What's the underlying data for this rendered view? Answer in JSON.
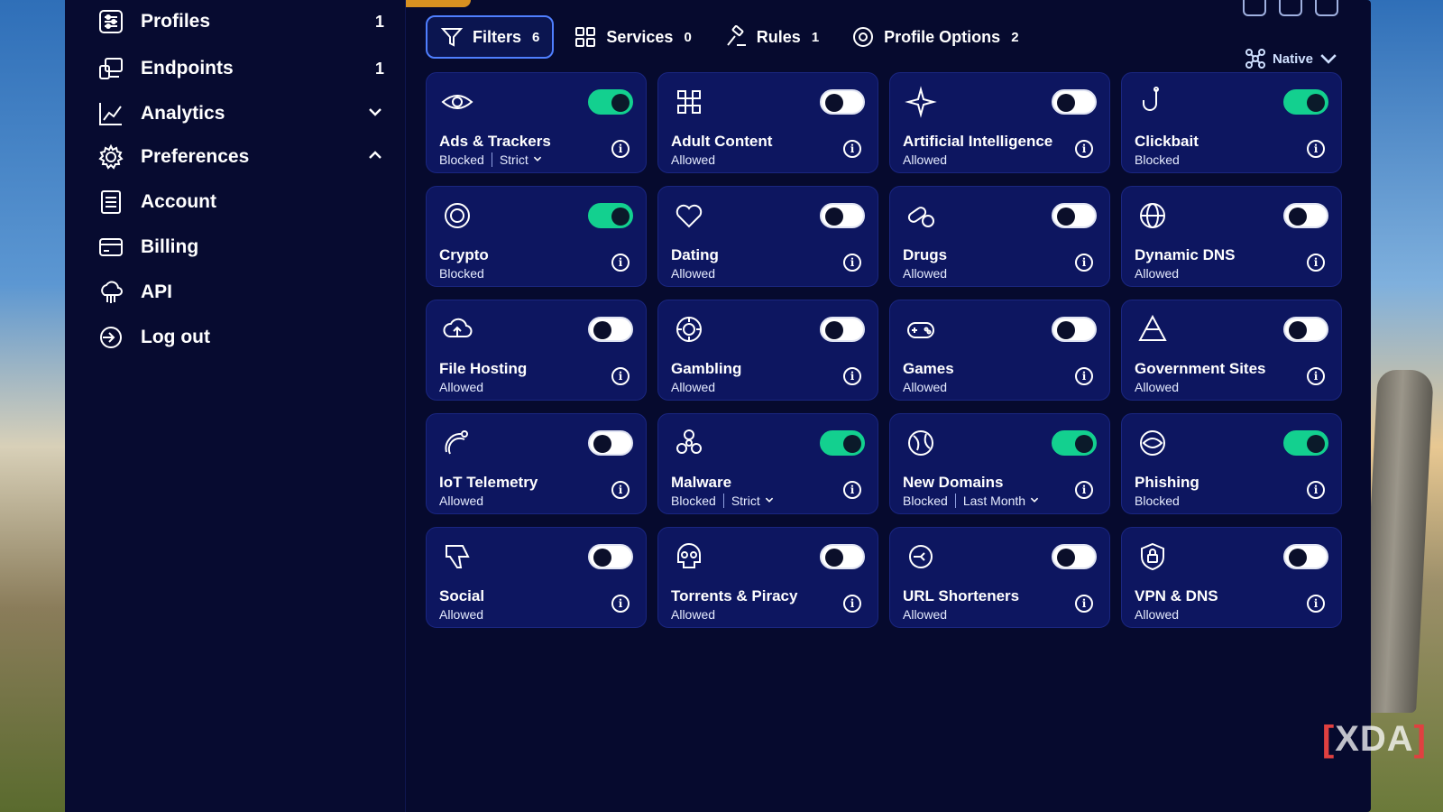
{
  "sidebar": {
    "items": [
      {
        "label": "Profiles",
        "right": "1"
      },
      {
        "label": "Endpoints",
        "right": "1"
      },
      {
        "label": "Analytics",
        "right": "chevron-down"
      },
      {
        "label": "Preferences",
        "right": "chevron-up"
      },
      {
        "label": "Account",
        "right": ""
      },
      {
        "label": "Billing",
        "right": ""
      },
      {
        "label": "API",
        "right": ""
      },
      {
        "label": "Log out",
        "right": ""
      }
    ]
  },
  "tabs": [
    {
      "label": "Filters",
      "count": "6",
      "active": true
    },
    {
      "label": "Services",
      "count": "0",
      "active": false
    },
    {
      "label": "Rules",
      "count": "1",
      "active": false
    },
    {
      "label": "Profile Options",
      "count": "2",
      "active": false
    }
  ],
  "mode": {
    "label": "Native"
  },
  "filters": [
    {
      "name": "Ads & Trackers",
      "status": "Blocked",
      "extra": "Strict",
      "on": true,
      "icon": "eye-icon"
    },
    {
      "name": "Adult Content",
      "status": "Allowed",
      "extra": "",
      "on": false,
      "icon": "pixel-blur-icon"
    },
    {
      "name": "Artificial Intelligence",
      "status": "Allowed",
      "extra": "",
      "on": false,
      "icon": "sparkle-icon"
    },
    {
      "name": "Clickbait",
      "status": "Blocked",
      "extra": "",
      "on": true,
      "icon": "hook-icon"
    },
    {
      "name": "Crypto",
      "status": "Blocked",
      "extra": "",
      "on": true,
      "icon": "coin-icon"
    },
    {
      "name": "Dating",
      "status": "Allowed",
      "extra": "",
      "on": false,
      "icon": "hearts-icon"
    },
    {
      "name": "Drugs",
      "status": "Allowed",
      "extra": "",
      "on": false,
      "icon": "pills-icon"
    },
    {
      "name": "Dynamic DNS",
      "status": "Allowed",
      "extra": "",
      "on": false,
      "icon": "globe-grid-icon"
    },
    {
      "name": "File Hosting",
      "status": "Allowed",
      "extra": "",
      "on": false,
      "icon": "cloud-upload-icon"
    },
    {
      "name": "Gambling",
      "status": "Allowed",
      "extra": "",
      "on": false,
      "icon": "chip-icon"
    },
    {
      "name": "Games",
      "status": "Allowed",
      "extra": "",
      "on": false,
      "icon": "gamepad-icon"
    },
    {
      "name": "Government Sites",
      "status": "Allowed",
      "extra": "",
      "on": false,
      "icon": "pyramid-icon"
    },
    {
      "name": "IoT Telemetry",
      "status": "Allowed",
      "extra": "",
      "on": false,
      "icon": "satellite-dish-icon"
    },
    {
      "name": "Malware",
      "status": "Blocked",
      "extra": "Strict",
      "on": true,
      "icon": "biohazard-icon"
    },
    {
      "name": "New Domains",
      "status": "Blocked",
      "extra": "Last Month",
      "on": true,
      "icon": "new-globe-icon"
    },
    {
      "name": "Phishing",
      "status": "Blocked",
      "extra": "",
      "on": true,
      "icon": "fish-globe-icon"
    },
    {
      "name": "Social",
      "status": "Allowed",
      "extra": "",
      "on": false,
      "icon": "thumbs-down-icon"
    },
    {
      "name": "Torrents & Piracy",
      "status": "Allowed",
      "extra": "",
      "on": false,
      "icon": "skull-icon"
    },
    {
      "name": "URL Shorteners",
      "status": "Allowed",
      "extra": "",
      "on": false,
      "icon": "link-shrink-icon"
    },
    {
      "name": "VPN & DNS",
      "status": "Allowed",
      "extra": "",
      "on": false,
      "icon": "shield-lock-icon"
    }
  ],
  "watermark": {
    "left": "[",
    "right": "]",
    "text": "XDA"
  },
  "colors": {
    "accent": "#13d08f",
    "card": "#0d1660",
    "background": "#060a2e",
    "active_tab_border": "#4f7fff"
  }
}
